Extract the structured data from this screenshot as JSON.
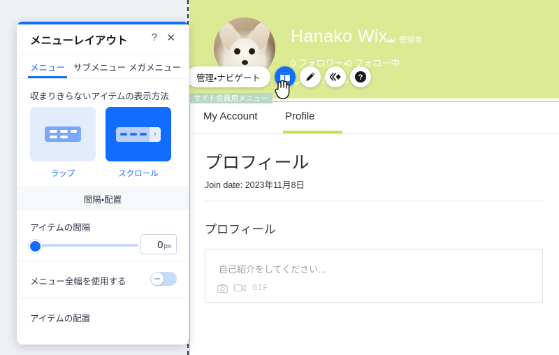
{
  "panel": {
    "title": "メニューレイアウト",
    "help_icon": "?",
    "close_icon": "✕",
    "tabs": [
      {
        "label": "メニュー",
        "selected": true
      },
      {
        "label": "サブメニュー",
        "selected": false
      },
      {
        "label": "メガメニュー",
        "selected": false
      }
    ],
    "overflow": {
      "title": "収まりきらないアイテムの表示方法",
      "options": [
        {
          "label": "ラップ",
          "selected": false
        },
        {
          "label": "スクロール",
          "selected": true
        }
      ]
    },
    "spacing_section_title": "間隔・配置",
    "item_spacing": {
      "label": "アイテムの間隔",
      "value": "0",
      "unit": "px"
    },
    "full_width": {
      "label": "メニュー全幅を使用する",
      "state": "off"
    },
    "item_alignment": {
      "label": "アイテムの配置"
    },
    "accent_color": "#116dff"
  },
  "toolbar": {
    "manage_label": "管理・ナビゲート",
    "buttons": [
      {
        "name": "layout-icon",
        "active": true
      },
      {
        "name": "design-pen-icon",
        "active": false
      },
      {
        "name": "animation-icon",
        "active": false
      },
      {
        "name": "help-icon",
        "active": false
      }
    ]
  },
  "selection_badge": {
    "label": "サイト会員用メニュー",
    "color": "#b9d9c7"
  },
  "member_header": {
    "name": "Hanako Wix",
    "admin_label": "管理者",
    "followers": "0 フォロワー・0 フォロー中",
    "tagline": "してください",
    "background_color": "#dcea93"
  },
  "member_tabs": [
    {
      "label": "My Account",
      "selected": false
    },
    {
      "label": "Profile",
      "selected": true
    }
  ],
  "profile": {
    "title": "プロフィール",
    "join_date": "Join date: 2023年11月8日",
    "section_title": "プロフィール",
    "bio_placeholder": "自己紹介をしてください...",
    "tools": [
      "camera-icon",
      "video-icon",
      "GIF"
    ],
    "underline_color": "#c6e24f"
  }
}
